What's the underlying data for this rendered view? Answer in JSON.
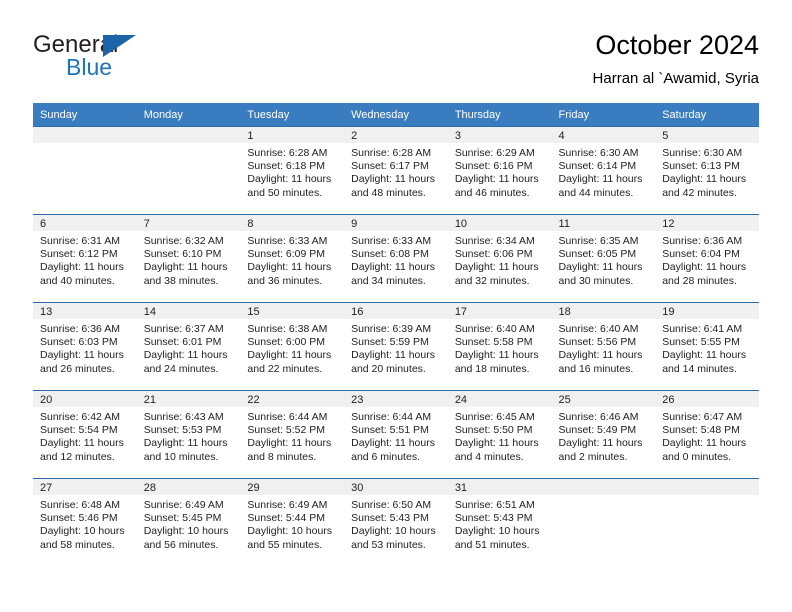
{
  "brand": {
    "name_top": "General",
    "name_bottom": "Blue",
    "accent_color": "#1b75bb"
  },
  "header": {
    "title": "October 2024",
    "subtitle": "Harran al `Awamid, Syria",
    "header_bg_color": "#3a7cc0"
  },
  "weekdays": [
    "Sunday",
    "Monday",
    "Tuesday",
    "Wednesday",
    "Thursday",
    "Friday",
    "Saturday"
  ],
  "weeks": [
    [
      {
        "day": "",
        "sunrise": "",
        "sunset": "",
        "daylight1": "",
        "daylight2": ""
      },
      {
        "day": "",
        "sunrise": "",
        "sunset": "",
        "daylight1": "",
        "daylight2": ""
      },
      {
        "day": "1",
        "sunrise": "Sunrise: 6:28 AM",
        "sunset": "Sunset: 6:18 PM",
        "daylight1": "Daylight: 11 hours",
        "daylight2": "and 50 minutes."
      },
      {
        "day": "2",
        "sunrise": "Sunrise: 6:28 AM",
        "sunset": "Sunset: 6:17 PM",
        "daylight1": "Daylight: 11 hours",
        "daylight2": "and 48 minutes."
      },
      {
        "day": "3",
        "sunrise": "Sunrise: 6:29 AM",
        "sunset": "Sunset: 6:16 PM",
        "daylight1": "Daylight: 11 hours",
        "daylight2": "and 46 minutes."
      },
      {
        "day": "4",
        "sunrise": "Sunrise: 6:30 AM",
        "sunset": "Sunset: 6:14 PM",
        "daylight1": "Daylight: 11 hours",
        "daylight2": "and 44 minutes."
      },
      {
        "day": "5",
        "sunrise": "Sunrise: 6:30 AM",
        "sunset": "Sunset: 6:13 PM",
        "daylight1": "Daylight: 11 hours",
        "daylight2": "and 42 minutes."
      }
    ],
    [
      {
        "day": "6",
        "sunrise": "Sunrise: 6:31 AM",
        "sunset": "Sunset: 6:12 PM",
        "daylight1": "Daylight: 11 hours",
        "daylight2": "and 40 minutes."
      },
      {
        "day": "7",
        "sunrise": "Sunrise: 6:32 AM",
        "sunset": "Sunset: 6:10 PM",
        "daylight1": "Daylight: 11 hours",
        "daylight2": "and 38 minutes."
      },
      {
        "day": "8",
        "sunrise": "Sunrise: 6:33 AM",
        "sunset": "Sunset: 6:09 PM",
        "daylight1": "Daylight: 11 hours",
        "daylight2": "and 36 minutes."
      },
      {
        "day": "9",
        "sunrise": "Sunrise: 6:33 AM",
        "sunset": "Sunset: 6:08 PM",
        "daylight1": "Daylight: 11 hours",
        "daylight2": "and 34 minutes."
      },
      {
        "day": "10",
        "sunrise": "Sunrise: 6:34 AM",
        "sunset": "Sunset: 6:06 PM",
        "daylight1": "Daylight: 11 hours",
        "daylight2": "and 32 minutes."
      },
      {
        "day": "11",
        "sunrise": "Sunrise: 6:35 AM",
        "sunset": "Sunset: 6:05 PM",
        "daylight1": "Daylight: 11 hours",
        "daylight2": "and 30 minutes."
      },
      {
        "day": "12",
        "sunrise": "Sunrise: 6:36 AM",
        "sunset": "Sunset: 6:04 PM",
        "daylight1": "Daylight: 11 hours",
        "daylight2": "and 28 minutes."
      }
    ],
    [
      {
        "day": "13",
        "sunrise": "Sunrise: 6:36 AM",
        "sunset": "Sunset: 6:03 PM",
        "daylight1": "Daylight: 11 hours",
        "daylight2": "and 26 minutes."
      },
      {
        "day": "14",
        "sunrise": "Sunrise: 6:37 AM",
        "sunset": "Sunset: 6:01 PM",
        "daylight1": "Daylight: 11 hours",
        "daylight2": "and 24 minutes."
      },
      {
        "day": "15",
        "sunrise": "Sunrise: 6:38 AM",
        "sunset": "Sunset: 6:00 PM",
        "daylight1": "Daylight: 11 hours",
        "daylight2": "and 22 minutes."
      },
      {
        "day": "16",
        "sunrise": "Sunrise: 6:39 AM",
        "sunset": "Sunset: 5:59 PM",
        "daylight1": "Daylight: 11 hours",
        "daylight2": "and 20 minutes."
      },
      {
        "day": "17",
        "sunrise": "Sunrise: 6:40 AM",
        "sunset": "Sunset: 5:58 PM",
        "daylight1": "Daylight: 11 hours",
        "daylight2": "and 18 minutes."
      },
      {
        "day": "18",
        "sunrise": "Sunrise: 6:40 AM",
        "sunset": "Sunset: 5:56 PM",
        "daylight1": "Daylight: 11 hours",
        "daylight2": "and 16 minutes."
      },
      {
        "day": "19",
        "sunrise": "Sunrise: 6:41 AM",
        "sunset": "Sunset: 5:55 PM",
        "daylight1": "Daylight: 11 hours",
        "daylight2": "and 14 minutes."
      }
    ],
    [
      {
        "day": "20",
        "sunrise": "Sunrise: 6:42 AM",
        "sunset": "Sunset: 5:54 PM",
        "daylight1": "Daylight: 11 hours",
        "daylight2": "and 12 minutes."
      },
      {
        "day": "21",
        "sunrise": "Sunrise: 6:43 AM",
        "sunset": "Sunset: 5:53 PM",
        "daylight1": "Daylight: 11 hours",
        "daylight2": "and 10 minutes."
      },
      {
        "day": "22",
        "sunrise": "Sunrise: 6:44 AM",
        "sunset": "Sunset: 5:52 PM",
        "daylight1": "Daylight: 11 hours",
        "daylight2": "and 8 minutes."
      },
      {
        "day": "23",
        "sunrise": "Sunrise: 6:44 AM",
        "sunset": "Sunset: 5:51 PM",
        "daylight1": "Daylight: 11 hours",
        "daylight2": "and 6 minutes."
      },
      {
        "day": "24",
        "sunrise": "Sunrise: 6:45 AM",
        "sunset": "Sunset: 5:50 PM",
        "daylight1": "Daylight: 11 hours",
        "daylight2": "and 4 minutes."
      },
      {
        "day": "25",
        "sunrise": "Sunrise: 6:46 AM",
        "sunset": "Sunset: 5:49 PM",
        "daylight1": "Daylight: 11 hours",
        "daylight2": "and 2 minutes."
      },
      {
        "day": "26",
        "sunrise": "Sunrise: 6:47 AM",
        "sunset": "Sunset: 5:48 PM",
        "daylight1": "Daylight: 11 hours",
        "daylight2": "and 0 minutes."
      }
    ],
    [
      {
        "day": "27",
        "sunrise": "Sunrise: 6:48 AM",
        "sunset": "Sunset: 5:46 PM",
        "daylight1": "Daylight: 10 hours",
        "daylight2": "and 58 minutes."
      },
      {
        "day": "28",
        "sunrise": "Sunrise: 6:49 AM",
        "sunset": "Sunset: 5:45 PM",
        "daylight1": "Daylight: 10 hours",
        "daylight2": "and 56 minutes."
      },
      {
        "day": "29",
        "sunrise": "Sunrise: 6:49 AM",
        "sunset": "Sunset: 5:44 PM",
        "daylight1": "Daylight: 10 hours",
        "daylight2": "and 55 minutes."
      },
      {
        "day": "30",
        "sunrise": "Sunrise: 6:50 AM",
        "sunset": "Sunset: 5:43 PM",
        "daylight1": "Daylight: 10 hours",
        "daylight2": "and 53 minutes."
      },
      {
        "day": "31",
        "sunrise": "Sunrise: 6:51 AM",
        "sunset": "Sunset: 5:43 PM",
        "daylight1": "Daylight: 10 hours",
        "daylight2": "and 51 minutes."
      },
      {
        "day": "",
        "sunrise": "",
        "sunset": "",
        "daylight1": "",
        "daylight2": ""
      },
      {
        "day": "",
        "sunrise": "",
        "sunset": "",
        "daylight1": "",
        "daylight2": ""
      }
    ]
  ]
}
